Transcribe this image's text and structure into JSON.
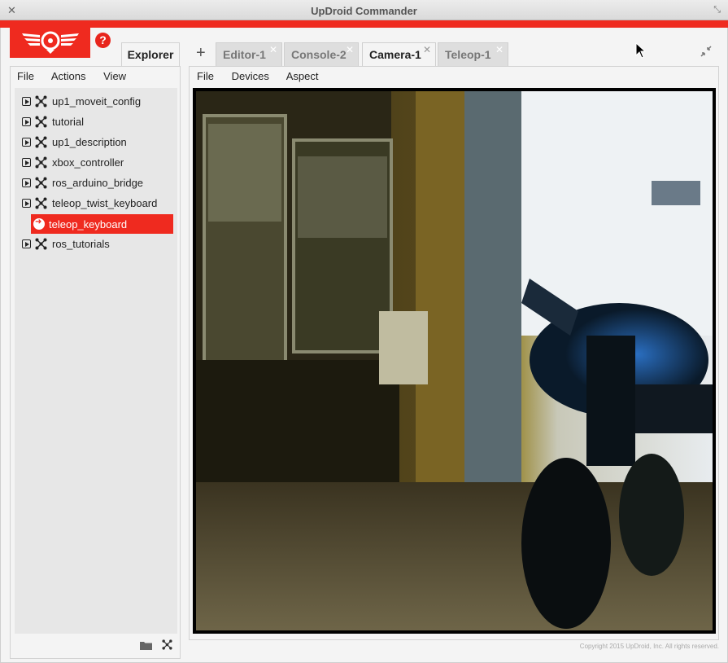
{
  "window": {
    "title": "UpDroid Commander",
    "close_glyph": "✕",
    "maximize_glyph": "⤡"
  },
  "colors": {
    "brand_red": "#ef2a1f",
    "selected_bg": "#ef2a1f"
  },
  "help": {
    "glyph": "?"
  },
  "explorer": {
    "tab_label": "Explorer",
    "menu": [
      "File",
      "Actions",
      "View"
    ],
    "items": [
      {
        "label": "up1_moveit_config"
      },
      {
        "label": "tutorial"
      },
      {
        "label": "up1_description"
      },
      {
        "label": "xbox_controller"
      },
      {
        "label": "ros_arduino_bridge"
      },
      {
        "label": "teleop_twist_keyboard"
      },
      {
        "label": "teleop_keyboard",
        "selected": true
      },
      {
        "label": "ros_tutorials"
      }
    ],
    "footer_icons": [
      "folder-icon",
      "node-icon"
    ]
  },
  "workspace": {
    "add_tab_glyph": "+",
    "tabs": [
      {
        "label": "Editor-1"
      },
      {
        "label": "Console-2"
      },
      {
        "label": "Camera-1",
        "active": true
      },
      {
        "label": "Teleop-1"
      }
    ],
    "tab_close_glyph": "✕",
    "menu": [
      "File",
      "Devices",
      "Aspect"
    ]
  },
  "footer": {
    "copyright": "Copyright 2015 UpDroid, Inc. All rights reserved."
  }
}
